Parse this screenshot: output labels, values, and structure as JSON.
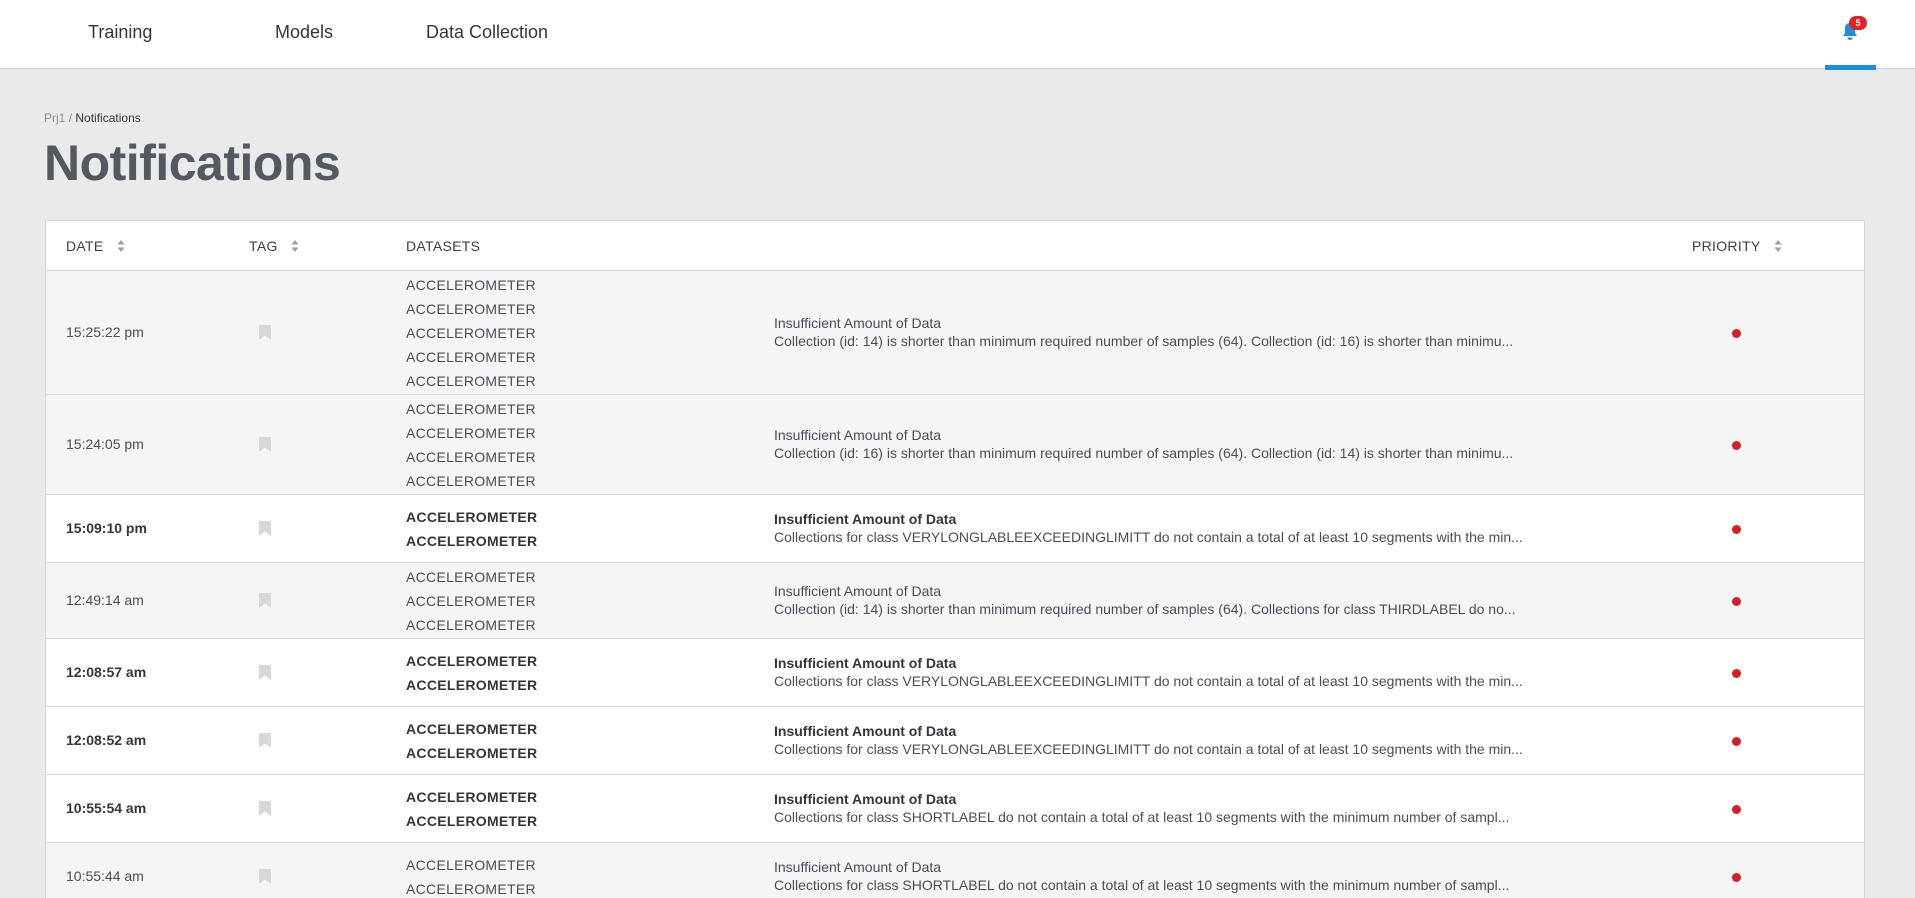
{
  "nav": {
    "items": [
      {
        "label": "Training"
      },
      {
        "label": "Models"
      },
      {
        "label": "Data Collection"
      }
    ],
    "notification_count": "5"
  },
  "breadcrumb": {
    "project": "Prj1",
    "separator": "/",
    "current": "Notifications"
  },
  "page_title": "Notifications",
  "table": {
    "headers": {
      "date": "DATE",
      "tag": "TAG",
      "datasets": "DATASETS",
      "priority": "PRIORITY"
    },
    "priority_color": "#d32020",
    "rows": [
      {
        "date": "15:25:22 pm",
        "unread": false,
        "datasets": [
          "ACCELEROMETER",
          "ACCELEROMETER",
          "ACCELEROMETER",
          "ACCELEROMETER",
          "ACCELEROMETER"
        ],
        "title": "Insufficient Amount of Data",
        "text": "Collection (id: 14) is shorter than minimum required number of samples (64). Collection (id: 16) is shorter than minimu..."
      },
      {
        "date": "15:24:05 pm",
        "unread": false,
        "datasets": [
          "ACCELEROMETER",
          "ACCELEROMETER",
          "ACCELEROMETER",
          "ACCELEROMETER"
        ],
        "title": "Insufficient Amount of Data",
        "text": "Collection (id: 16) is shorter than minimum required number of samples (64). Collection (id: 14) is shorter than minimu..."
      },
      {
        "date": "15:09:10 pm",
        "unread": true,
        "datasets": [
          "ACCELEROMETER",
          "ACCELEROMETER"
        ],
        "title": "Insufficient Amount of Data",
        "text": "Collections for class VERYLONGLABLEEXCEEDINGLIMITT do not contain a total of at least 10 segments with the min..."
      },
      {
        "date": "12:49:14 am",
        "unread": false,
        "datasets": [
          "ACCELEROMETER",
          "ACCELEROMETER",
          "ACCELEROMETER"
        ],
        "title": "Insufficient Amount of Data",
        "text": "Collection (id: 14) is shorter than minimum required number of samples (64). Collections for class THIRDLABEL do no..."
      },
      {
        "date": "12:08:57 am",
        "unread": true,
        "datasets": [
          "ACCELEROMETER",
          "ACCELEROMETER"
        ],
        "title": "Insufficient Amount of Data",
        "text": "Collections for class VERYLONGLABLEEXCEEDINGLIMITT do not contain a total of at least 10 segments with the min..."
      },
      {
        "date": "12:08:52 am",
        "unread": true,
        "datasets": [
          "ACCELEROMETER",
          "ACCELEROMETER"
        ],
        "title": "Insufficient Amount of Data",
        "text": "Collections for class VERYLONGLABLEEXCEEDINGLIMITT do not contain a total of at least 10 segments with the min..."
      },
      {
        "date": "10:55:54 am",
        "unread": true,
        "datasets": [
          "ACCELEROMETER",
          "ACCELEROMETER"
        ],
        "title": "Insufficient Amount of Data",
        "text": "Collections for class SHORTLABEL do not contain a total of at least 10 segments with the minimum number of sampl..."
      },
      {
        "date": "10:55:44 am",
        "unread": false,
        "datasets": [
          "ACCELEROMETER",
          "ACCELEROMETER"
        ],
        "title": "Insufficient Amount of Data",
        "text": "Collections for class SHORTLABEL do not contain a total of at least 10 segments with the minimum number of sampl..."
      }
    ]
  }
}
